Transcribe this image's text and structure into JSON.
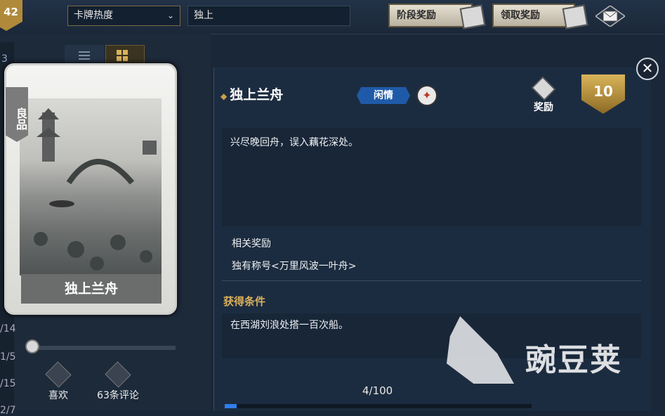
{
  "topbar": {
    "level": "42",
    "sort_select": "卡牌热度",
    "search_value": "独上",
    "stage_reward_label": "阶段奖励",
    "claim_reward_label": "领取奖励"
  },
  "sidebar": {
    "partial_labels": [
      "3",
      "/14",
      "1/5",
      "/15",
      "2/7"
    ]
  },
  "card": {
    "rarity": "良品",
    "title": "独上兰舟",
    "likes_label": "喜欢",
    "comments_label": "63条评论"
  },
  "detail": {
    "title": "独上兰舟",
    "tag": "闲情",
    "reward_label": "奖励",
    "reward_level": "10",
    "description": "兴尽晚回舟，误入藕花深处。",
    "related_reward_heading": "相关奖励",
    "related_reward_value": "独有称号<万里风波一叶舟>",
    "condition_heading": "获得条件",
    "condition_text": "在西湖刘浪处搭一百次船。",
    "progress_text": "4/100",
    "progress_value": 0.04
  },
  "watermark": {
    "text": "豌豆荚"
  },
  "colors": {
    "accent_gold": "#d9b15c",
    "tag_blue": "#1f5aa8",
    "progress_blue": "#2f7ef0"
  }
}
